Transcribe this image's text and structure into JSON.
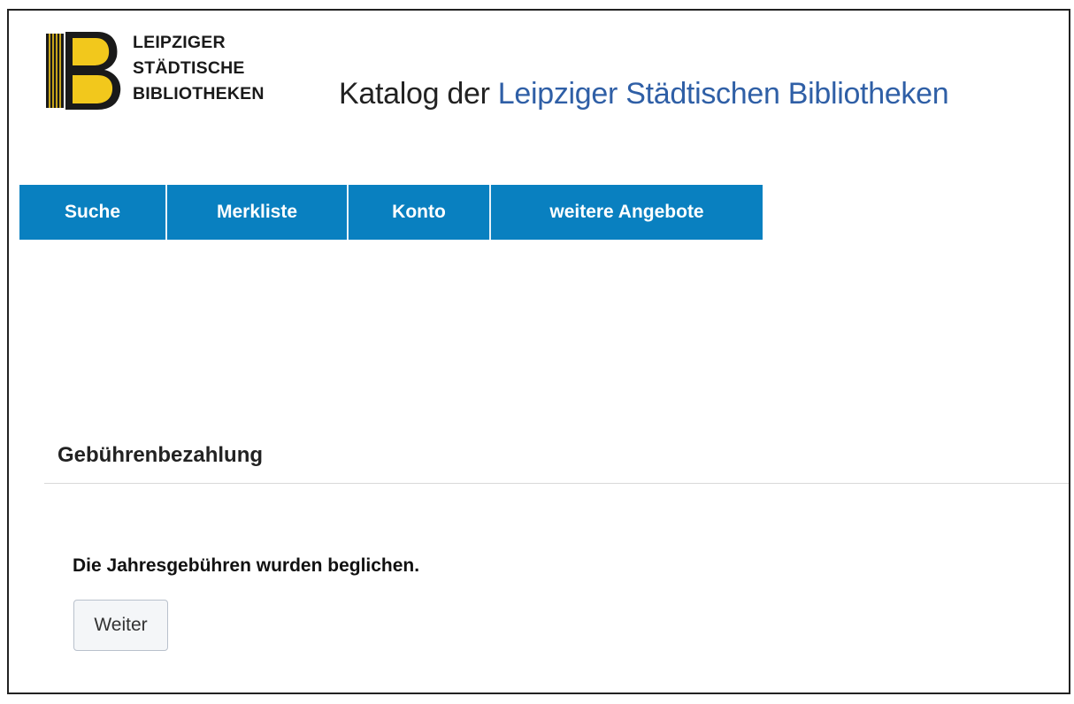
{
  "logo": {
    "lines": [
      "LEIPZIGER",
      "STÄDTISCHE",
      "BIBLIOTHEKEN"
    ],
    "colors": {
      "yellow": "#f2c81c",
      "black": "#1a1a1a"
    }
  },
  "header": {
    "title_prefix": "Katalog der",
    "title_accent": "Leipziger Städtischen Bibliotheken",
    "accent_color": "#2f5fa6"
  },
  "nav": {
    "background_color": "#0980c0",
    "items": [
      {
        "label": "Suche"
      },
      {
        "label": "Merkliste"
      },
      {
        "label": "Konto"
      },
      {
        "label": "weitere Angebote"
      }
    ]
  },
  "page": {
    "section_title": "Gebührenbezahlung",
    "message": "Die Jahresgebühren wurden beglichen.",
    "continue_button_label": "Weiter"
  }
}
